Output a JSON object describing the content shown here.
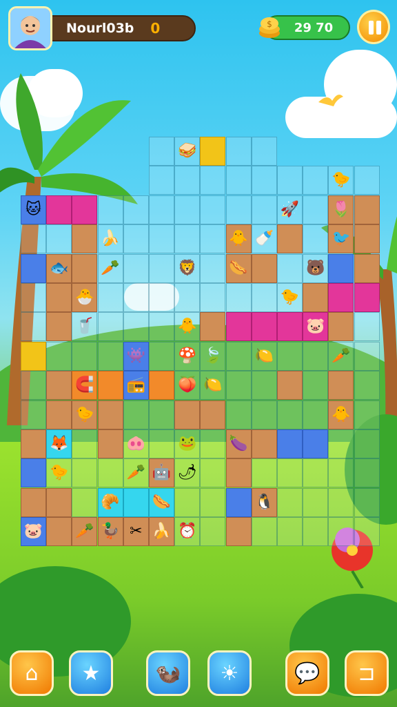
{
  "hud": {
    "player_name": "Nourl03b",
    "level": "0",
    "coins": "29 70",
    "avatar_icon": "player-portrait",
    "coin_icon": "coin-stack-icon",
    "pause_icon": "pause-icon"
  },
  "board": {
    "cols": 13,
    "rows": 14,
    "cells": [
      [
        "",
        "",
        "",
        "",
        "",
        "empty",
        "empty",
        "yellow",
        "empty",
        "empty",
        "",
        "",
        "",
        ""
      ],
      [
        "",
        "",
        "",
        "",
        "",
        "empty",
        "empty",
        "empty",
        "empty",
        "empty",
        "empty",
        "empty",
        "empty",
        "empty"
      ],
      [
        "blue",
        "pink",
        "pink",
        "empty",
        "empty",
        "empty",
        "empty",
        "empty",
        "empty",
        "empty",
        "empty",
        "empty",
        "dirt",
        "dirt"
      ],
      [
        "empty",
        "empty",
        "dirt",
        "empty",
        "empty",
        "empty",
        "empty",
        "empty",
        "dirt",
        "empty",
        "dirt",
        "empty",
        "dirt",
        "dirt"
      ],
      [
        "blue",
        "dirt",
        "dirt",
        "empty",
        "empty",
        "empty",
        "empty",
        "empty",
        "dirt",
        "dirt",
        "empty",
        "empty",
        "blue",
        "dirt"
      ],
      [
        "empty",
        "dirt",
        "dirt",
        "empty",
        "empty",
        "empty",
        "empty",
        "empty",
        "empty",
        "empty",
        "empty",
        "dirt",
        "pink",
        "pink"
      ],
      [
        "empty",
        "dirt",
        "empty",
        "empty",
        "empty",
        "empty",
        "empty",
        "dirt",
        "pink",
        "pink",
        "pink",
        "pink",
        "dirt",
        "empty"
      ],
      [
        "yellow",
        "empty",
        "empty",
        "empty",
        "blue",
        "empty",
        "empty",
        "empty",
        "empty",
        "empty",
        "empty",
        "empty",
        "empty",
        "empty"
      ],
      [
        "empty",
        "dirt",
        "orange",
        "orange",
        "blue",
        "orange",
        "empty",
        "empty",
        "empty",
        "empty",
        "dirt",
        "empty",
        "dirt",
        "empty"
      ],
      [
        "empty",
        "dirt",
        "dirt",
        "dirt",
        "empty",
        "empty",
        "dirt",
        "dirt",
        "empty",
        "empty",
        "empty",
        "empty",
        "dirt",
        "empty"
      ],
      [
        "dirt",
        "cyan",
        "empty",
        "dirt",
        "empty",
        "empty",
        "empty",
        "empty",
        "dirt",
        "dirt",
        "blue",
        "blue",
        "empty",
        "empty"
      ],
      [
        "blue",
        "empty",
        "empty",
        "empty",
        "empty",
        "dirt",
        "empty",
        "empty",
        "dirt",
        "empty",
        "empty",
        "empty",
        "empty",
        "empty"
      ],
      [
        "dirt",
        "dirt",
        "empty",
        "cyan",
        "cyan",
        "cyan",
        "empty",
        "empty",
        "blue",
        "dirt",
        "empty",
        "empty",
        "empty",
        "empty"
      ],
      [
        "blue",
        "dirt",
        "dirt",
        "dirt",
        "dirt",
        "dirt",
        "empty",
        "empty",
        "dirt",
        "empty",
        "empty",
        "empty",
        "empty",
        "empty"
      ]
    ]
  },
  "pieces": [
    {
      "icon": "sandwich-icon",
      "glyph": "🥪",
      "col": 6,
      "row": 0
    },
    {
      "icon": "chick-icon",
      "glyph": "🐤",
      "col": 12,
      "row": 1
    },
    {
      "icon": "cat-icon",
      "glyph": "🐱",
      "col": 0,
      "row": 2
    },
    {
      "icon": "banana-icon",
      "glyph": "🍌",
      "col": 3,
      "row": 3
    },
    {
      "icon": "rocket-icon",
      "glyph": "🚀",
      "col": 10,
      "row": 2
    },
    {
      "icon": "tulip-icon",
      "glyph": "🌷",
      "col": 12,
      "row": 2
    },
    {
      "icon": "chick-icon",
      "glyph": "🐥",
      "col": 8,
      "row": 3
    },
    {
      "icon": "bottle-icon",
      "glyph": "🍼",
      "col": 9,
      "row": 3
    },
    {
      "icon": "fish-icon",
      "glyph": "🐟",
      "col": 1,
      "row": 4
    },
    {
      "icon": "carrot-icon",
      "glyph": "🥕",
      "col": 3,
      "row": 4
    },
    {
      "icon": "lion-icon",
      "glyph": "🦁",
      "col": 6,
      "row": 4
    },
    {
      "icon": "sausage-icon",
      "glyph": "🌭",
      "col": 8,
      "row": 4
    },
    {
      "icon": "bear-icon",
      "glyph": "🐻",
      "col": 11,
      "row": 4
    },
    {
      "icon": "bird-icon",
      "glyph": "🐦",
      "col": 12,
      "row": 3
    },
    {
      "icon": "chick-icon",
      "glyph": "🐣",
      "col": 2,
      "row": 5
    },
    {
      "icon": "chick-icon",
      "glyph": "🐤",
      "col": 10,
      "row": 5
    },
    {
      "icon": "drink-icon",
      "glyph": "🥤",
      "col": 2,
      "row": 6
    },
    {
      "icon": "chick-icon",
      "glyph": "🐥",
      "col": 6,
      "row": 6
    },
    {
      "icon": "pig-icon",
      "glyph": "🐷",
      "col": 11,
      "row": 6
    },
    {
      "icon": "blob-icon",
      "glyph": "👾",
      "col": 4,
      "row": 7
    },
    {
      "icon": "mushroom-icon",
      "glyph": "🍄",
      "col": 6,
      "row": 7
    },
    {
      "icon": "leaf-icon",
      "glyph": "🍃",
      "col": 7,
      "row": 7
    },
    {
      "icon": "lemon-icon",
      "glyph": "🍋",
      "col": 9,
      "row": 7
    },
    {
      "icon": "carrot-icon",
      "glyph": "🥕",
      "col": 12,
      "row": 7
    },
    {
      "icon": "magnet-icon",
      "glyph": "🧲",
      "col": 2,
      "row": 8
    },
    {
      "icon": "radio-icon",
      "glyph": "📻",
      "col": 4,
      "row": 8
    },
    {
      "icon": "peach-icon",
      "glyph": "🍑",
      "col": 6,
      "row": 8
    },
    {
      "icon": "lemon-icon",
      "glyph": "🍋",
      "col": 7,
      "row": 8
    },
    {
      "icon": "chick-icon",
      "glyph": "🐤",
      "col": 2,
      "row": 9
    },
    {
      "icon": "chick-icon",
      "glyph": "🐥",
      "col": 12,
      "row": 9
    },
    {
      "icon": "fox-icon",
      "glyph": "🦊",
      "col": 1,
      "row": 10
    },
    {
      "icon": "pig-icon",
      "glyph": "🐽",
      "col": 4,
      "row": 10
    },
    {
      "icon": "frog-icon",
      "glyph": "🐸",
      "col": 6,
      "row": 10
    },
    {
      "icon": "eggplant-icon",
      "glyph": "🍆",
      "col": 8,
      "row": 10
    },
    {
      "icon": "bird-icon",
      "glyph": "🐤",
      "col": 1,
      "row": 11
    },
    {
      "icon": "carrot-icon",
      "glyph": "🥕",
      "col": 4,
      "row": 11
    },
    {
      "icon": "robot-icon",
      "glyph": "🤖",
      "col": 5,
      "row": 11
    },
    {
      "icon": "chili-icon",
      "glyph": "🌶",
      "col": 6,
      "row": 11
    },
    {
      "icon": "cookie-icon",
      "glyph": "🥐",
      "col": 3,
      "row": 12
    },
    {
      "icon": "sausage-icon",
      "glyph": "🌭",
      "col": 5,
      "row": 12
    },
    {
      "icon": "penguin-icon",
      "glyph": "🐧",
      "col": 9,
      "row": 12
    },
    {
      "icon": "pig-icon",
      "glyph": "🐷",
      "col": 0,
      "row": 13
    },
    {
      "icon": "carrot-icon",
      "glyph": "🥕",
      "col": 2,
      "row": 13
    },
    {
      "icon": "duck-icon",
      "glyph": "🦆",
      "col": 3,
      "row": 13
    },
    {
      "icon": "scissors-icon",
      "glyph": "✂",
      "col": 4,
      "row": 13
    },
    {
      "icon": "banana-icon",
      "glyph": "🍌",
      "col": 5,
      "row": 13
    },
    {
      "icon": "clock-icon",
      "glyph": "⏰",
      "col": 6,
      "row": 13
    }
  ],
  "bottom_bar": [
    {
      "name": "home-button",
      "icon": "home-icon",
      "glyph": "⌂",
      "style": "orange"
    },
    {
      "name": "star-button",
      "icon": "star-icon",
      "glyph": "★",
      "style": "blue"
    },
    {
      "name": "character-button",
      "icon": "otter-icon",
      "glyph": "🦦",
      "style": "blue"
    },
    {
      "name": "sun-button",
      "icon": "sun-icon",
      "glyph": "☀",
      "style": "blue"
    },
    {
      "name": "chat-button",
      "icon": "speech-bubble-icon",
      "glyph": "💬",
      "style": "orange"
    },
    {
      "name": "exit-button",
      "icon": "exit-icon",
      "glyph": "⊐",
      "style": "orange"
    }
  ],
  "colors": {
    "sky": "#2ec3ef",
    "grass": "#7fd06a",
    "accent_orange": "#f28a00",
    "coin_green": "#37c24a"
  }
}
